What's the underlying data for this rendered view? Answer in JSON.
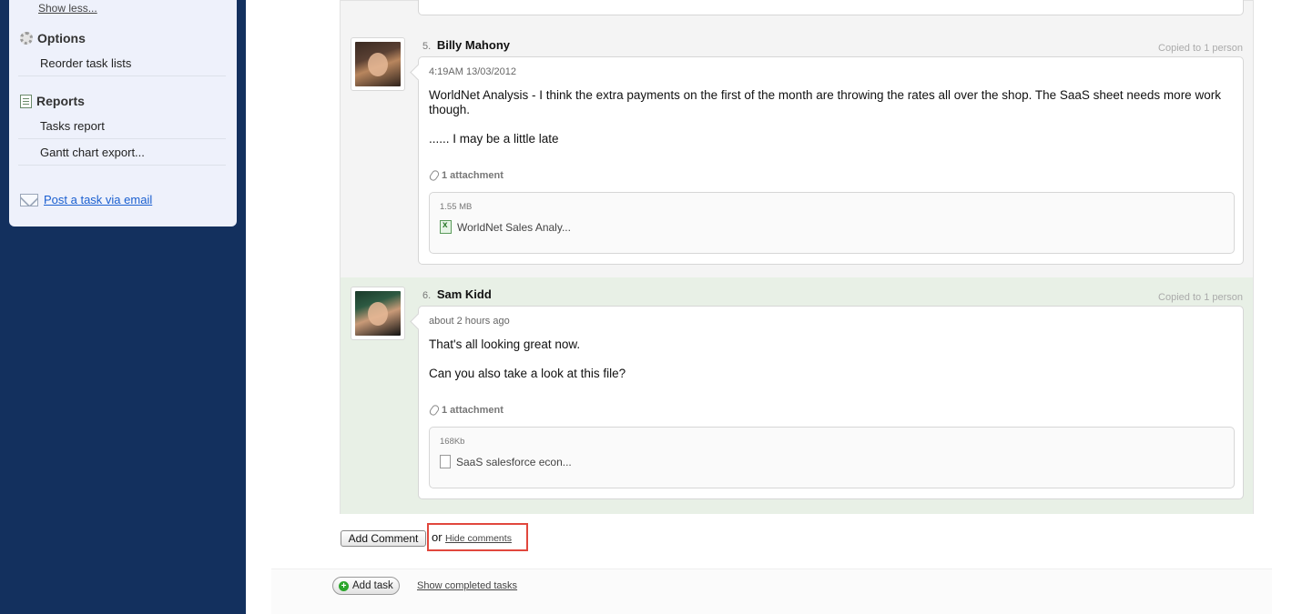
{
  "sidebar": {
    "show_less": "Show less...",
    "options": {
      "title": "Options",
      "items": [
        "Reorder task lists"
      ]
    },
    "reports": {
      "title": "Reports",
      "items": [
        "Tasks report",
        "Gantt chart export..."
      ]
    },
    "email_link": "Post a task via email"
  },
  "comments": [
    {
      "number": "5.",
      "author": "Billy Mahony",
      "copied": "Copied to 1 person",
      "timestamp": "4:19AM 13/03/2012",
      "paragraphs": [
        "WorldNet Analysis - I think the extra payments on the first of the month are throwing the rates all over the shop. The SaaS sheet needs more work though.",
        "...... I may be a little late"
      ],
      "attachment_label": "1 attachment",
      "file_size": "1.55 MB",
      "file_name": "WorldNet Sales Analy..."
    },
    {
      "number": "6.",
      "author": "Sam Kidd",
      "copied": "Copied to 1 person",
      "timestamp": "about 2 hours ago",
      "paragraphs": [
        "That's all looking great now.",
        "Can you also take a look at this file?"
      ],
      "attachment_label": "1 attachment",
      "file_size": "168Kb",
      "file_name": "SaaS salesforce econ..."
    }
  ],
  "actions": {
    "add_comment": "Add Comment",
    "or": "or",
    "hide_comments": "Hide comments",
    "add_task": "Add task",
    "show_completed": "Show completed tasks"
  },
  "colors": {
    "page_background": "#13305e",
    "sidebar_background": "#eef1fb",
    "highlight_border": "#e1473d",
    "new_comment_background": "#e8f0e6"
  },
  "icons": [
    "gear-icon",
    "reports-icon",
    "envelope-icon",
    "paperclip-icon",
    "spreadsheet-file-icon",
    "document-file-icon",
    "plus-icon"
  ]
}
